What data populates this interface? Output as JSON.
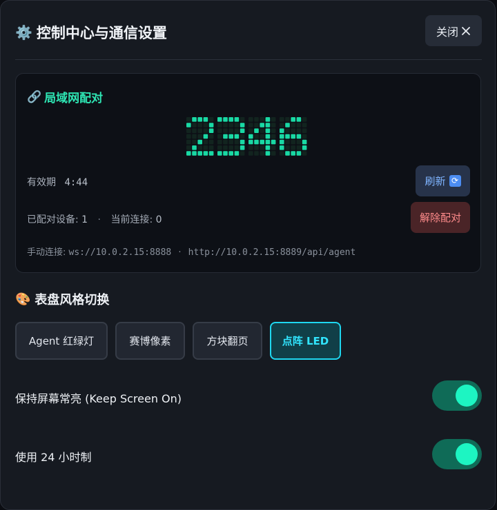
{
  "header": {
    "title": "控制中心与通信设置",
    "close_label": "关闭"
  },
  "pairing": {
    "title": "局域网配对",
    "code": "2346",
    "valid_label": "有效期",
    "valid_value": "4:44",
    "refresh_label": "刷新",
    "paired_label": "已配对设备:",
    "paired_count": "1",
    "separator": "·",
    "current_label": "当前连接:",
    "current_count": "0",
    "unpair_label": "解除配对",
    "manual_label": "手动连接:",
    "ws_url": "ws://10.0.2.15:8888",
    "http_url": "http://10.0.2.15:8889/api/agent"
  },
  "styles": {
    "title": "表盘风格切换",
    "options": [
      "Agent 红绿灯",
      "赛博像素",
      "方块翻页",
      "点阵 LED"
    ],
    "selected": "点阵 LED"
  },
  "settings": [
    {
      "label": "保持屏幕常亮 (Keep Screen On)",
      "enabled": true
    },
    {
      "label": "使用 24 小时制",
      "enabled": true
    }
  ],
  "colors": {
    "accent": "#2ee6b4",
    "led": "#19d9a4",
    "active_border": "#1fd7f0",
    "danger": "#ff8b8b"
  },
  "icons": {
    "title": "gear-icon",
    "close": "close-icon",
    "pair": "link-icon",
    "refresh": "refresh-icon",
    "style": "palette-icon"
  }
}
